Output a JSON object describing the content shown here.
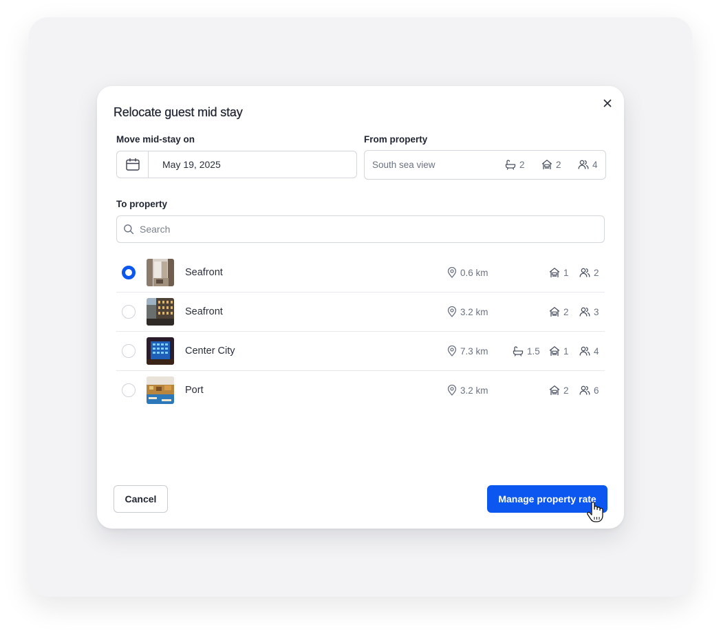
{
  "modal": {
    "title": "Relocate guest mid stay",
    "close_icon": "close-icon"
  },
  "move_date": {
    "label": "Move mid-stay on",
    "value": "May 19, 2025",
    "icon": "calendar-icon"
  },
  "from_property": {
    "label": "From property",
    "name": "South sea view",
    "bathrooms": "2",
    "bedrooms": "2",
    "guests": "4"
  },
  "to_property": {
    "label": "To property",
    "search_placeholder": "Search",
    "properties": [
      {
        "name": "Seafront",
        "distance": "0.6 km",
        "bathrooms": "",
        "bedrooms": "1",
        "guests": "2",
        "selected": true
      },
      {
        "name": "Seafront",
        "distance": "3.2 km",
        "bathrooms": "",
        "bedrooms": "2",
        "guests": "3",
        "selected": false
      },
      {
        "name": "Center City",
        "distance": "7.3 km",
        "bathrooms": "1.5",
        "bedrooms": "1",
        "guests": "4",
        "selected": false
      },
      {
        "name": "Port",
        "distance": "3.2 km",
        "bathrooms": "",
        "bedrooms": "2",
        "guests": "6",
        "selected": false
      }
    ]
  },
  "footer": {
    "cancel_label": "Cancel",
    "primary_label": "Manage property rate"
  },
  "colors": {
    "accent": "#0b57f0",
    "backdrop": "#f3f3f5",
    "muted_text": "#6b7280"
  },
  "icons": [
    "close-icon",
    "calendar-icon",
    "bathtub-icon",
    "bed-house-icon",
    "guests-icon",
    "search-icon",
    "location-pin-icon",
    "hand-cursor-icon"
  ]
}
